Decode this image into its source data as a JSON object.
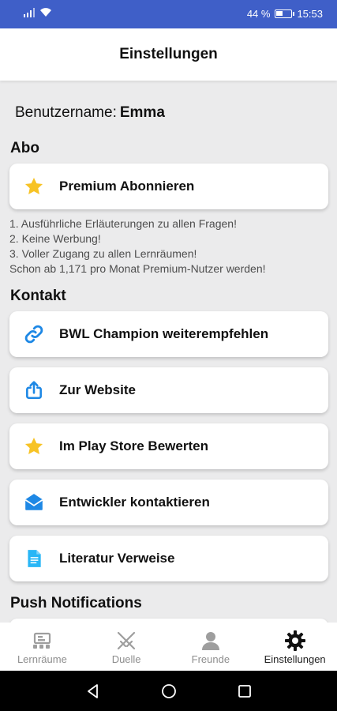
{
  "status": {
    "battery": "44 %",
    "time": "15:53"
  },
  "header": {
    "title": "Einstellungen"
  },
  "user": {
    "label": "Benutzername:",
    "name": "Emma"
  },
  "abo": {
    "title": "Abo",
    "premium_label": "Premium Abonnieren",
    "benefits": [
      "1. Ausführliche Erläuterungen zu allen Fragen!",
      "2. Keine Werbung!",
      "3. Voller Zugang zu allen Lernräumen!",
      "Schon ab 1,171 pro Monat Premium-Nutzer werden!"
    ]
  },
  "kontakt": {
    "title": "Kontakt",
    "items": [
      {
        "label": "BWL Champion weiterempfehlen",
        "icon": "link-icon"
      },
      {
        "label": "Zur Website",
        "icon": "share-icon"
      },
      {
        "label": "Im Play Store Bewerten",
        "icon": "star-icon"
      },
      {
        "label": "Entwickler kontaktieren",
        "icon": "mail-icon"
      },
      {
        "label": "Literatur Verweise",
        "icon": "document-icon"
      }
    ]
  },
  "push": {
    "title": "Push Notifications"
  },
  "tabs": [
    {
      "label": "Lernräume",
      "icon": "classroom-icon"
    },
    {
      "label": "Duelle",
      "icon": "crossed-swords-icon"
    },
    {
      "label": "Freunde",
      "icon": "person-icon"
    },
    {
      "label": "Einstellungen",
      "icon": "gear-icon"
    }
  ],
  "colors": {
    "statusbar": "#3f5fc8",
    "accent_blue": "#1e88e5",
    "star": "#f7c325",
    "background": "#ebebec"
  }
}
